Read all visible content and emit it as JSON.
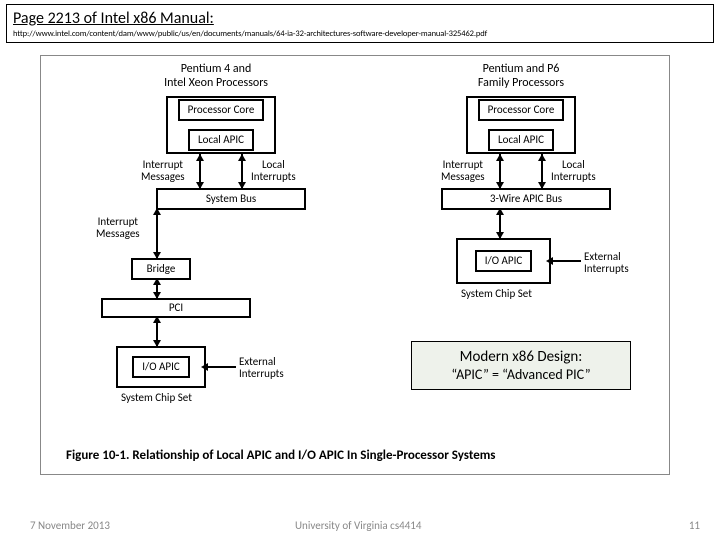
{
  "header": {
    "title": "Page 2213 of Intel x86 Manual:",
    "url": "http://www.intel.com/content/dam/www/public/us/en/documents/manuals/64-ia-32-architectures-software-developer-manual-325462.pdf"
  },
  "figure": {
    "left_title": "Pentium 4 and\nIntel Xeon Processors",
    "right_title": "Pentium and P6\nFamily Processors",
    "processor_core": "Processor Core",
    "local_apic": "Local APIC",
    "interrupt_messages": "Interrupt\nMessages",
    "local_interrupts": "Local\nInterrupts",
    "system_bus": "System Bus",
    "three_wire_apic_bus": "3-Wire APIC Bus",
    "bridge": "Bridge",
    "pci": "PCI",
    "io_apic": "I/O APIC",
    "external_interrupts": "External\nInterrupts",
    "system_chip_set": "System Chip Set",
    "caption": "Figure 10-1.  Relationship of Local APIC and I/O APIC In Single-Processor Systems"
  },
  "callout": {
    "line1": "Modern x86 Design:",
    "line2": "“APIC” = “Advanced PIC”"
  },
  "footer": {
    "date": "7 November 2013",
    "center": "University of Virginia cs4414",
    "page": "11"
  }
}
